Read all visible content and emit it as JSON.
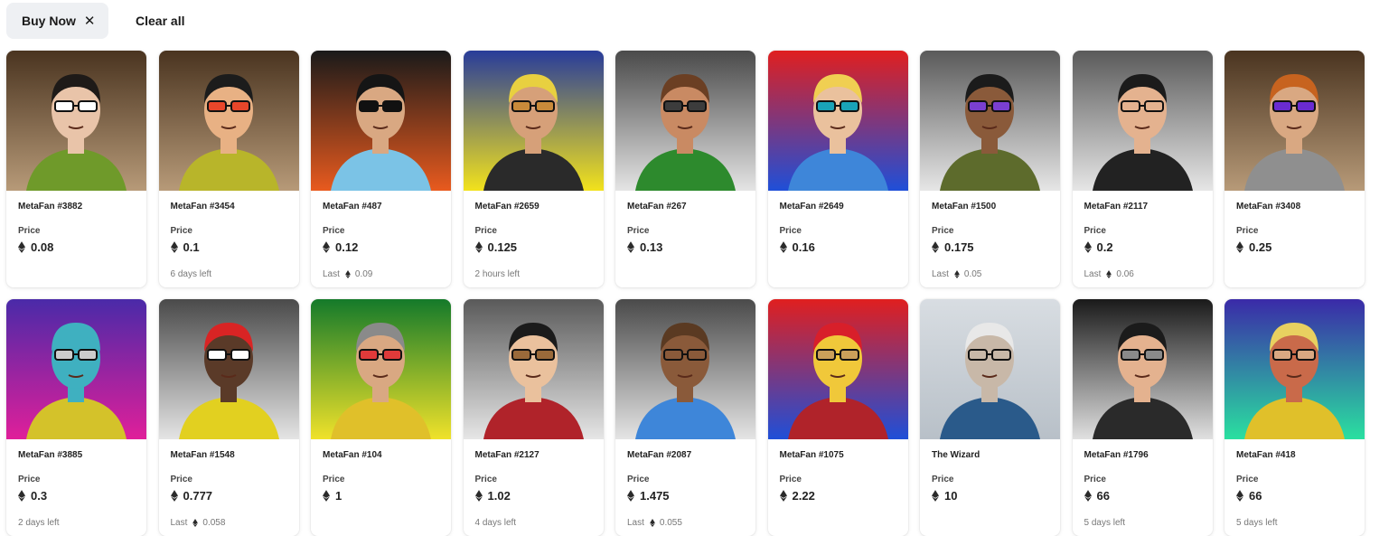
{
  "filters": {
    "active_chip_label": "Buy Now",
    "clear_label": "Clear all"
  },
  "price_label": "Price",
  "colors": {
    "accent": "#1a1a1a",
    "chip_bg": "#eef0f3"
  },
  "cards": [
    {
      "name": "MetaFan #3882",
      "price": "0.08",
      "meta_type": "none",
      "meta_text": "",
      "bg": [
        "#4a3420",
        "#b79a78"
      ],
      "skin": "#e9c4a9",
      "hair": "#1e1a18",
      "shirt": "#6f9a2a",
      "shades": "#ffffff"
    },
    {
      "name": "MetaFan #3454",
      "price": "0.1",
      "meta_type": "time",
      "meta_text": "6 days left",
      "bg": [
        "#4a3420",
        "#b79a78"
      ],
      "skin": "#e8b184",
      "hair": "#1c1c1c",
      "shirt": "#b8b52a",
      "shades": "#e8462a"
    },
    {
      "name": "MetaFan #487",
      "price": "0.12",
      "meta_type": "last",
      "meta_text": "Last",
      "meta_price": "0.09",
      "bg": [
        "#1a1a1a",
        "#e85a1e"
      ],
      "skin": "#d9a882",
      "hair": "#151515",
      "shirt": "#7bc3e6",
      "shades": "#111111"
    },
    {
      "name": "MetaFan #2659",
      "price": "0.125",
      "meta_type": "time",
      "meta_text": "2 hours left",
      "bg": [
        "#283c9a",
        "#f2e21c"
      ],
      "skin": "#d6a079",
      "hair": "#e8d040",
      "shirt": "#2a2a2a",
      "shades": "#c98a3a"
    },
    {
      "name": "MetaFan #267",
      "price": "0.13",
      "meta_type": "none",
      "meta_text": "",
      "bg": [
        "#4a4a4a",
        "#e4e4e4"
      ],
      "skin": "#c98a63",
      "hair": "#6b3f23",
      "shirt": "#2d8a2d",
      "shades": "#3c3c3c"
    },
    {
      "name": "MetaFan #2649",
      "price": "0.16",
      "meta_type": "none",
      "meta_text": "",
      "bg": [
        "#e01f1f",
        "#1f4fd8"
      ],
      "skin": "#eac19d",
      "hair": "#f0cf52",
      "shirt": "#3e86d9",
      "shades": "#19a3b8"
    },
    {
      "name": "MetaFan #1500",
      "price": "0.175",
      "meta_type": "last",
      "meta_text": "Last",
      "meta_price": "0.05",
      "bg": [
        "#5a5a5a",
        "#e6e6e6"
      ],
      "skin": "#8a5a3a",
      "hair": "#1b1b1b",
      "shirt": "#5d6b2c",
      "shades": "#7a3fd1"
    },
    {
      "name": "MetaFan #2117",
      "price": "0.2",
      "meta_type": "last",
      "meta_text": "Last",
      "meta_price": "0.06",
      "bg": [
        "#5a5a5a",
        "#e6e6e6"
      ],
      "skin": "#e4b28f",
      "hair": "#1b1b1b",
      "shirt": "#222222",
      "shades": "#e4b28f"
    },
    {
      "name": "MetaFan #3408",
      "price": "0.25",
      "meta_type": "none",
      "meta_text": "",
      "bg": [
        "#4a3420",
        "#b79a78"
      ],
      "skin": "#d9a882",
      "hair": "#c7631f",
      "shirt": "#8f8f8f",
      "shades": "#6a2bd1"
    },
    {
      "name": "MetaFan #3885",
      "price": "0.3",
      "meta_type": "time",
      "meta_text": "2 days left",
      "bg": [
        "#4a2aa8",
        "#e01f9a"
      ],
      "skin": "#3fb0c0",
      "hair": "#3fb0c0",
      "shirt": "#d4c22a",
      "shades": "#cccccc"
    },
    {
      "name": "MetaFan #1548",
      "price": "0.777",
      "meta_type": "last",
      "meta_text": "Last",
      "meta_price": "0.058",
      "bg": [
        "#4a4a4a",
        "#e4e4e4"
      ],
      "skin": "#5a3a28",
      "hair": "#d92424",
      "shirt": "#e2d020",
      "shades": "#ffffff"
    },
    {
      "name": "MetaFan #104",
      "price": "1",
      "meta_type": "none",
      "meta_text": "",
      "bg": [
        "#147a2a",
        "#f0e22a"
      ],
      "skin": "#d9a882",
      "hair": "#8a8a8a",
      "shirt": "#e0c02a",
      "shades": "#e03a3a"
    },
    {
      "name": "MetaFan #2127",
      "price": "1.02",
      "meta_type": "time",
      "meta_text": "4 days left",
      "bg": [
        "#5a5a5a",
        "#e6e6e6"
      ],
      "skin": "#eac19d",
      "hair": "#1b1b1b",
      "shirt": "#b0232a",
      "shades": "#9a6a3a"
    },
    {
      "name": "MetaFan #2087",
      "price": "1.475",
      "meta_type": "last",
      "meta_text": "Last",
      "meta_price": "0.055",
      "bg": [
        "#4a4a4a",
        "#e4e4e4"
      ],
      "skin": "#8a5a3a",
      "hair": "#5a3a22",
      "shirt": "#3e86d9",
      "shades": "#8a5a3a"
    },
    {
      "name": "MetaFan #1075",
      "price": "2.22",
      "meta_type": "none",
      "meta_text": "",
      "bg": [
        "#e01f1f",
        "#1f4fd8"
      ],
      "skin": "#f0c83a",
      "hair": "#d81f2a",
      "shirt": "#b0232a",
      "shades": "#caa05a"
    },
    {
      "name": "The Wizard",
      "price": "10",
      "meta_type": "none",
      "meta_text": "",
      "bg": [
        "#d8dde2",
        "#b8c0c8"
      ],
      "skin": "#c8b8a8",
      "hair": "#e8e8e8",
      "shirt": "#2a5a8a",
      "shades": "#c8b8a8"
    },
    {
      "name": "MetaFan #1796",
      "price": "66",
      "meta_type": "time",
      "meta_text": "5 days left",
      "bg": [
        "#1a1a1a",
        "#e0e0e0"
      ],
      "skin": "#e4b28f",
      "hair": "#1b1b1b",
      "shirt": "#2a2a2a",
      "shades": "#8a8a8a"
    },
    {
      "name": "MetaFan #418",
      "price": "66",
      "meta_type": "time",
      "meta_text": "5 days left",
      "bg": [
        "#3a2aa8",
        "#2ae0a0"
      ],
      "skin": "#c96a4a",
      "hair": "#e8d060",
      "shirt": "#e0c02a",
      "shades": "#d9a882"
    }
  ]
}
